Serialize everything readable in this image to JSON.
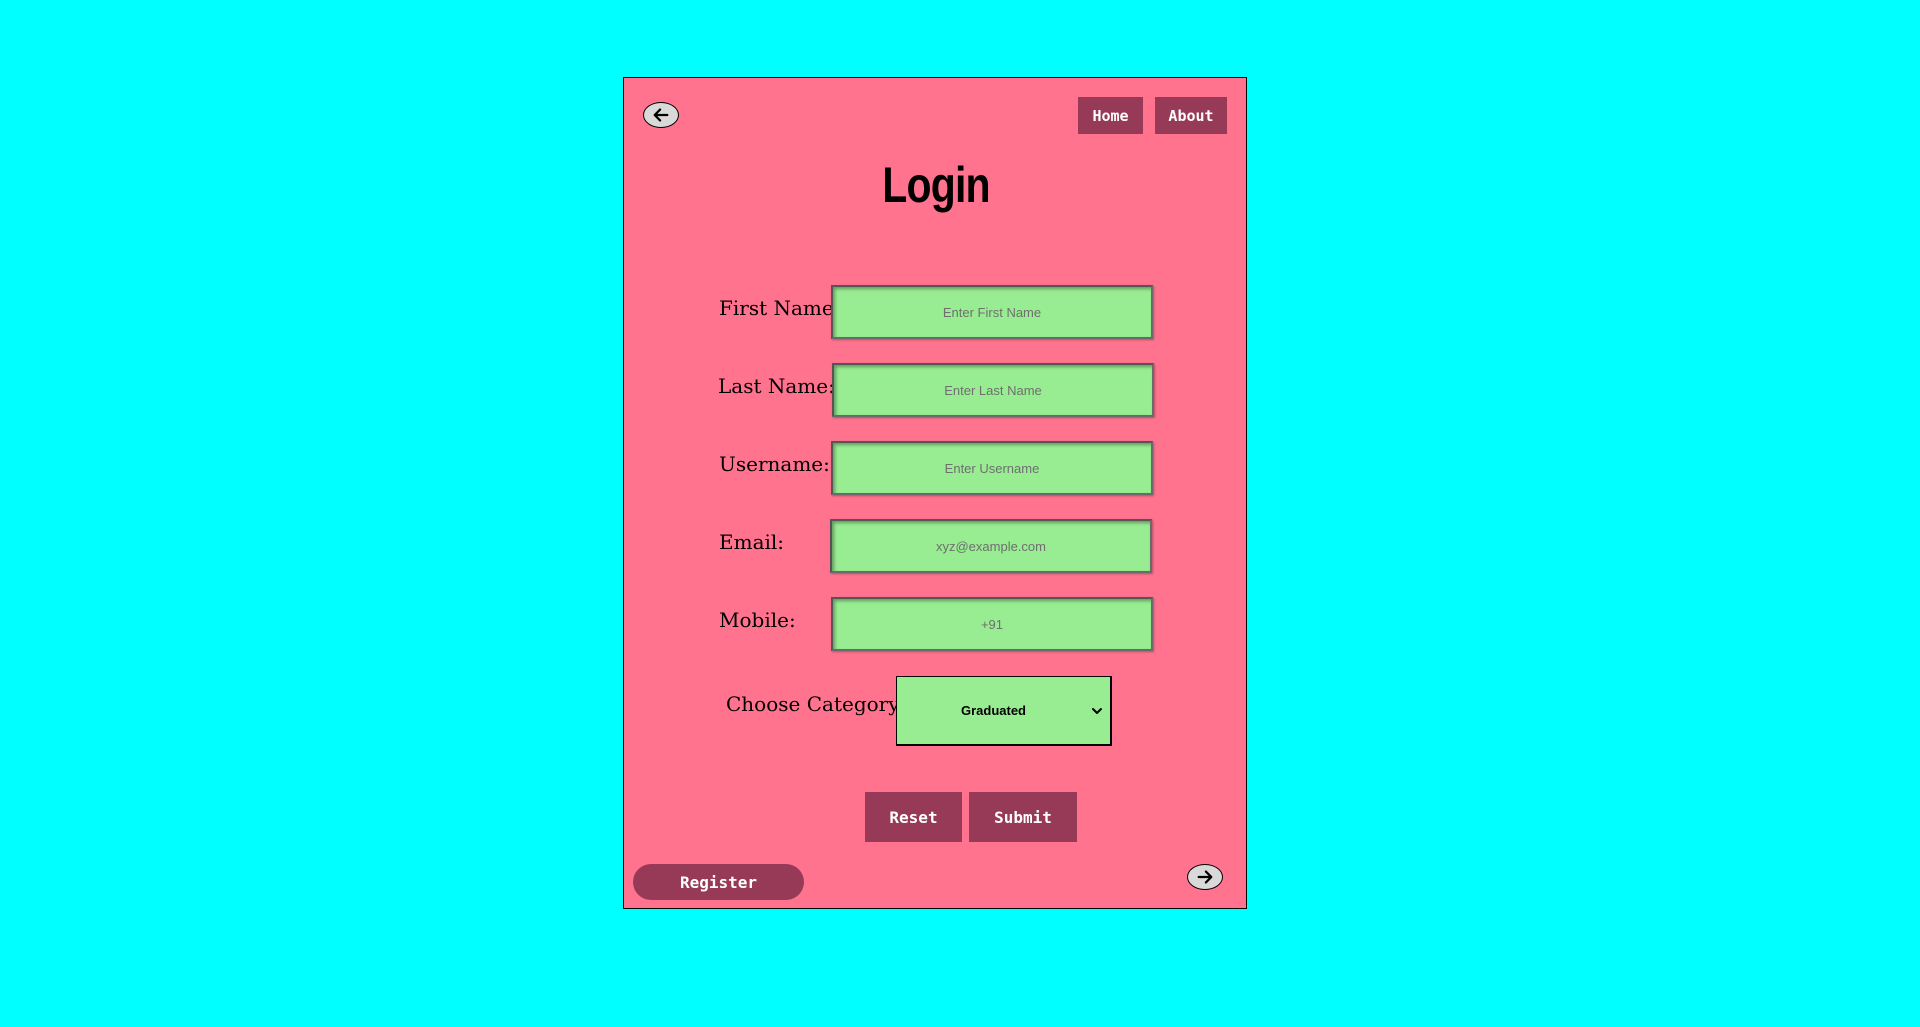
{
  "nav": {
    "home_label": "Home",
    "about_label": "About"
  },
  "page": {
    "title": "Login"
  },
  "form": {
    "first_name": {
      "label": "First Name:",
      "placeholder": "Enter First Name",
      "value": ""
    },
    "last_name": {
      "label": "Last Name:",
      "placeholder": "Enter Last Name",
      "value": ""
    },
    "username": {
      "label": "Username:",
      "placeholder": "Enter Username",
      "value": ""
    },
    "email": {
      "label": "Email:",
      "placeholder": "xyz@example.com",
      "value": ""
    },
    "mobile": {
      "label": "Mobile:",
      "placeholder": "+91",
      "value": ""
    },
    "category": {
      "label": "Choose Category:",
      "selected": "Graduated"
    }
  },
  "actions": {
    "reset_label": "Reset",
    "submit_label": "Submit",
    "register_label": "Register"
  },
  "icons": {
    "back": "arrow-left-icon",
    "forward": "arrow-right-icon",
    "select": "chevron-down-icon"
  },
  "colors": {
    "background": "#00ffff",
    "card": "#ff738f",
    "button": "#973a57",
    "field": "#98ec91"
  }
}
